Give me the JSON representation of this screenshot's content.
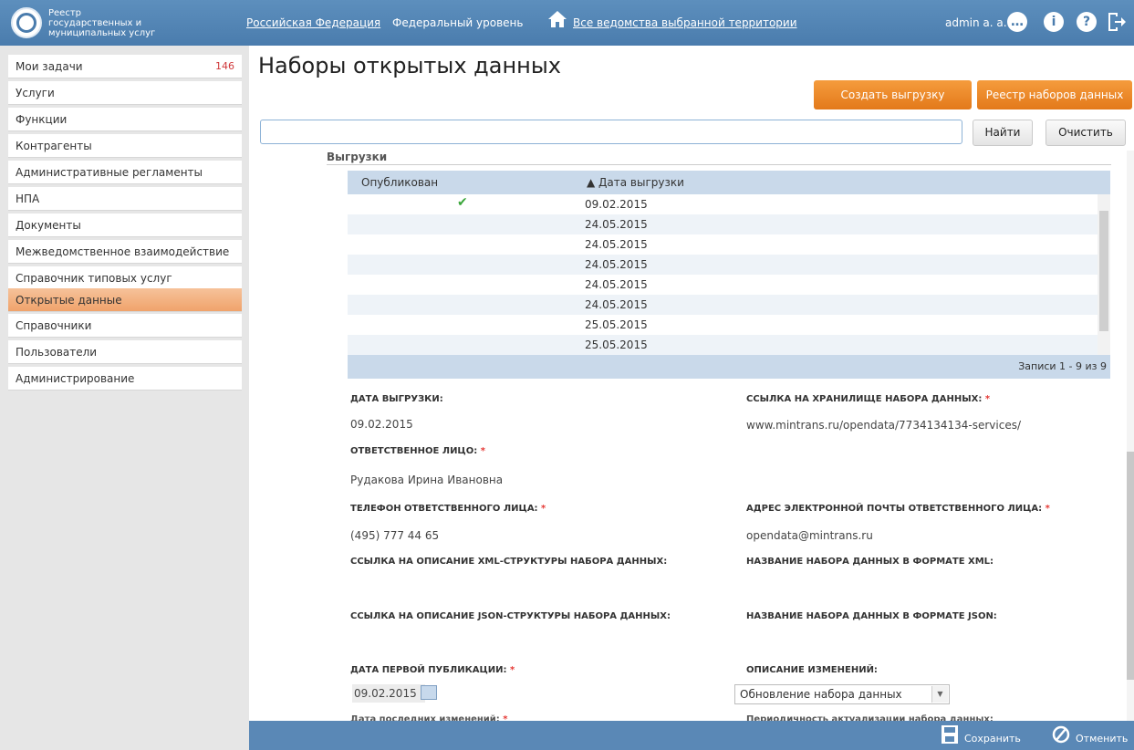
{
  "header": {
    "app_title": "Реестр государственных и муниципальных услуг",
    "nav_region": "Российская Федерация",
    "nav_level": "Федеральный уровень",
    "nav_departments": "Все ведомства выбранной территории",
    "user": "admin a. a."
  },
  "sidebar": {
    "items": [
      {
        "label": "Мои задачи",
        "count": "146"
      },
      {
        "label": "Услуги"
      },
      {
        "label": "Функции"
      },
      {
        "label": "Контрагенты"
      },
      {
        "label": "Административные регламенты"
      },
      {
        "label": "НПА"
      },
      {
        "label": "Документы"
      },
      {
        "label": "Межведомственное взаимодействие"
      },
      {
        "label": "Справочник типовых услуг"
      },
      {
        "label": "Открытые данные"
      },
      {
        "label": "Справочники"
      },
      {
        "label": "Пользователи"
      },
      {
        "label": "Администрирование"
      }
    ]
  },
  "main": {
    "title": "Наборы открытых данных",
    "create_button": "Создать выгрузку",
    "registry_button": "Реестр наборов данных",
    "search_value": "",
    "find_button": "Найти",
    "clear_button": "Очистить",
    "section_label": "Выгрузки",
    "grid": {
      "col_published": "Опубликован",
      "col_date": "▲ Дата выгрузки",
      "rows": [
        {
          "published": true,
          "date": "09.02.2015"
        },
        {
          "published": false,
          "date": "24.05.2015"
        },
        {
          "published": false,
          "date": "24.05.2015"
        },
        {
          "published": false,
          "date": "24.05.2015"
        },
        {
          "published": false,
          "date": "24.05.2015"
        },
        {
          "published": false,
          "date": "24.05.2015"
        },
        {
          "published": false,
          "date": "25.05.2015"
        },
        {
          "published": false,
          "date": "25.05.2015"
        }
      ],
      "footer": "Записи 1 - 9 из 9"
    },
    "form": {
      "export_date_label": "Дата выгрузки:",
      "export_date_value": "09.02.2015",
      "storage_link_label": "Ссылка на хранилище набора данных:",
      "storage_link_value": "www.mintrans.ru/opendata/7734134134-services/",
      "responsible_label": "Ответственное лицо:",
      "responsible_value": "Рудакова Ирина Ивановна",
      "phone_label": "Телефон ответственного лица:",
      "phone_value": "(495) 777 44 65",
      "email_label": "Адрес электронной почты ответственного лица:",
      "email_value": "opendata@mintrans.ru",
      "xml_struct_label": "Ссылка на описание XML-структуры набора данных:",
      "xml_name_label": "Название набора данных в формате XML:",
      "json_struct_label": "Ссылка на описание JSON-структуры набора данных:",
      "json_name_label": "Название набора данных в формате JSON:",
      "first_pub_label": "Дата первой публикации:",
      "first_pub_value": "09.02.2015",
      "changes_label": "Описание изменений:",
      "changes_value": "Обновление набора данных",
      "last_change_label": "Дата последних изменений:",
      "periodicity_label": "Периодичность актуализации набора данных:"
    },
    "save_button": "Сохранить",
    "cancel_button": "Отменить"
  }
}
